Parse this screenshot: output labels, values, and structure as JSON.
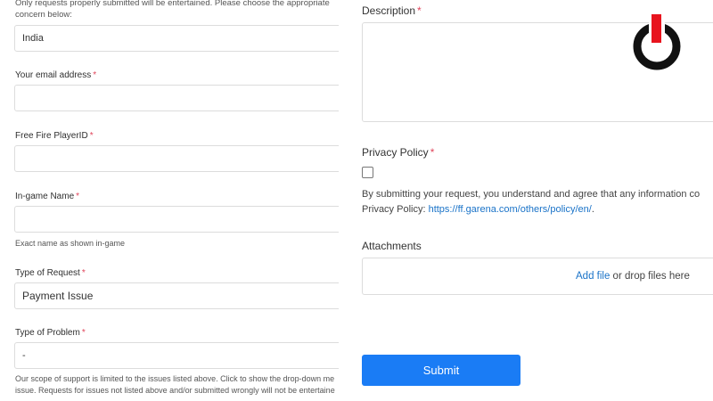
{
  "left": {
    "intro": "Only requests properly submitted will be entertained. Please choose the appropriate concern below:",
    "country_value": "India",
    "email_label": "Your email address",
    "playerid_label": "Free Fire PlayerID",
    "ingame_label": "In-game Name",
    "ingame_hint": "Exact name as shown in-game",
    "request_label": "Type of Request",
    "request_value": "Payment Issue",
    "problem_label": "Type of Problem",
    "problem_value": "-",
    "scope_text_1": "Our scope of support is limited to the issues listed above. Click to show the drop-down me",
    "scope_text_2": "issue. Requests for issues not listed above and/or submitted wrongly will not be entertaine",
    "required_mark": "*"
  },
  "right": {
    "description_label": "Description",
    "privacy_label": "Privacy Policy",
    "privacy_text_1": "By submitting your request, you understand and agree that any information co",
    "privacy_text_2_prefix": "Privacy Policy: ",
    "privacy_link": "https://ff.garena.com/others/policy/en/",
    "privacy_text_2_suffix": ".",
    "attachments_label": "Attachments",
    "add_file": "Add file",
    "drop_text": " or drop files here",
    "submit_label": "Submit",
    "required_mark": "*"
  },
  "colors": {
    "accent": "#1a7cf5",
    "required": "#e0455b",
    "link": "#1a73c8",
    "logo_red": "#e8141e"
  }
}
